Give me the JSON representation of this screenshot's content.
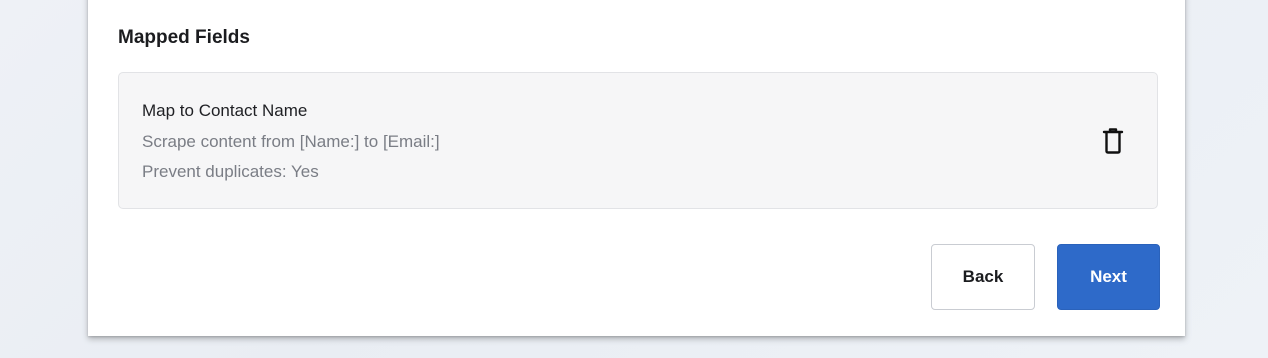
{
  "section": {
    "title": "Mapped Fields"
  },
  "mapping": {
    "title": "Map to Contact Name",
    "scrape_text": "Scrape content from [Name:] to [Email:]",
    "duplicates_text": "Prevent duplicates: Yes",
    "delete_icon": "trash-icon"
  },
  "actions": {
    "back_label": "Back",
    "next_label": "Next"
  },
  "colors": {
    "primary": "#2e6ac9",
    "card_bg": "#f6f6f7",
    "muted_text": "#7a7d85"
  }
}
